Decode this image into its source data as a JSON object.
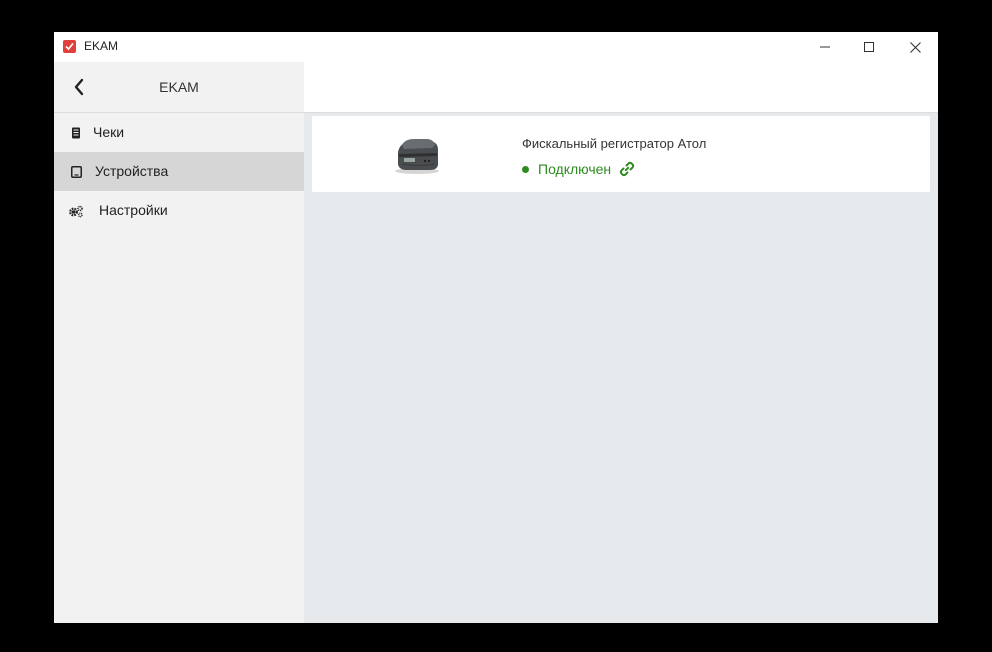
{
  "window": {
    "title": "EKAM",
    "logo_icon": "checkmark-logo-icon",
    "accent": "#e0403b",
    "controls": [
      "minimize-icon",
      "maximize-icon",
      "close-icon"
    ]
  },
  "sidebar": {
    "title": "EKAM",
    "back_icon": "chevron-left-icon",
    "items": [
      {
        "label": "Чеки",
        "icon": "receipt-icon",
        "active": false
      },
      {
        "label": "Устройства",
        "icon": "tablet-icon",
        "active": true
      },
      {
        "label": "Настройки",
        "icon": "gears-icon",
        "active": false
      }
    ]
  },
  "devices": [
    {
      "name": "Фискальный регистратор Атол",
      "status": "Подключен",
      "status_color": "#2e8b1f",
      "status_icon": "link-icon",
      "image": "fiscal-printer-image"
    }
  ]
}
